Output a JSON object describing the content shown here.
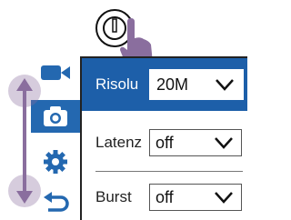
{
  "device": {
    "power_button_icon": "power-icon",
    "gesture_icon": "pointing-hand-icon"
  },
  "sidebar": {
    "items": [
      {
        "icon": "video-camera-icon",
        "active": false
      },
      {
        "icon": "camera-icon",
        "active": true
      },
      {
        "icon": "gear-icon",
        "active": false
      },
      {
        "icon": "back-arrow-icon",
        "active": false
      }
    ],
    "scroll_indicator_icon": "vertical-scroll-arrows-icon"
  },
  "settings": {
    "rows": [
      {
        "label": "Risolu",
        "value": "20M",
        "selected": true
      },
      {
        "label": "Latenz",
        "value": "off",
        "selected": false
      },
      {
        "label": "Burst",
        "value": "off",
        "selected": false
      }
    ]
  },
  "colors": {
    "accent": "#1d5fa9",
    "sidebar_active": "#2468b0",
    "gesture": "#8a6e9e"
  }
}
